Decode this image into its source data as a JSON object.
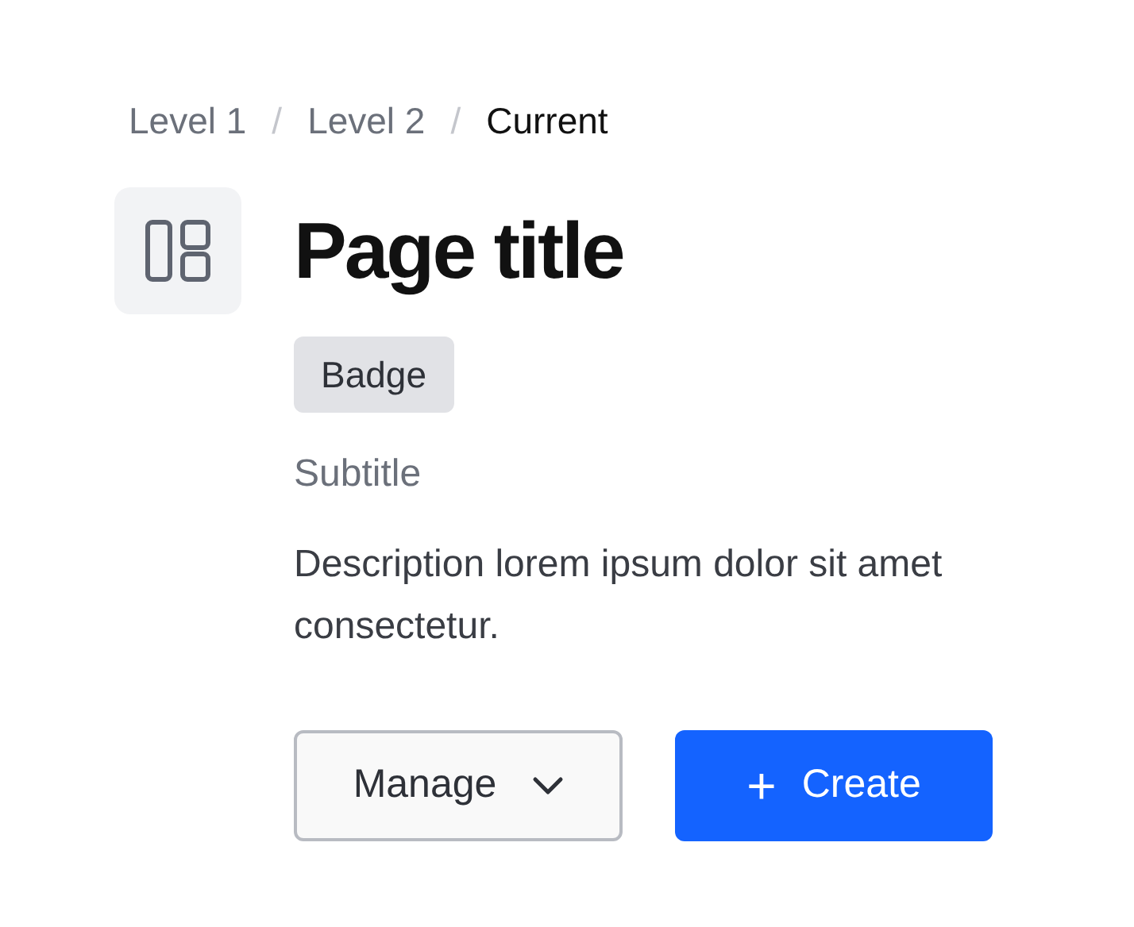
{
  "breadcrumb": [
    {
      "label": "Level 1",
      "selected": false
    },
    {
      "label": "Level 2",
      "selected": false
    },
    {
      "label": "Current",
      "selected": true
    }
  ],
  "breadcrumb_separator": "/",
  "title": "Page title",
  "badge": "Badge",
  "subtitle": "Subtitle",
  "description": "Description lorem ipsum dolor sit amet consectetur.",
  "buttons": [
    {
      "kind": "dropdown",
      "label": "Manage"
    },
    {
      "kind": "primary",
      "label": "Create",
      "icon_text": "+"
    }
  ]
}
